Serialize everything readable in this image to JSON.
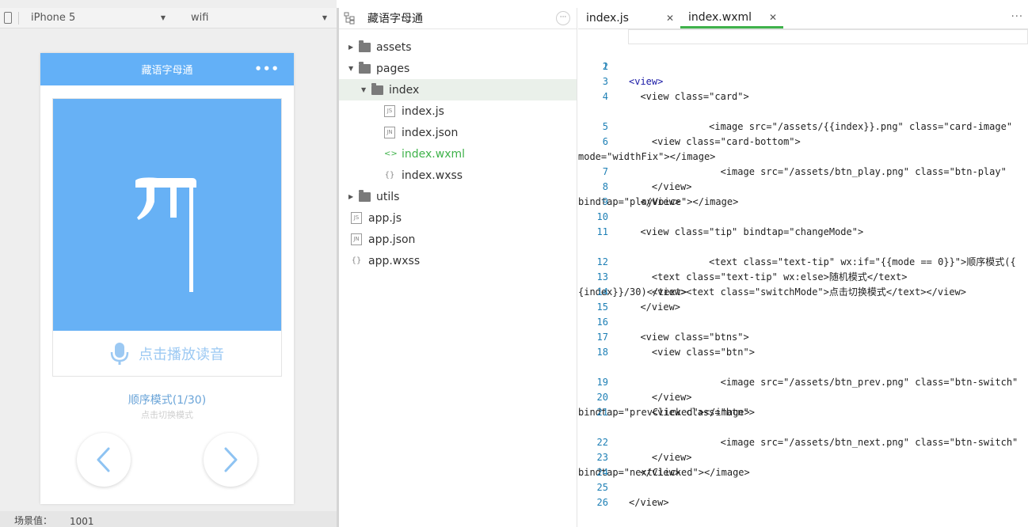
{
  "simulator": {
    "toolbar": {
      "device": "iPhone 5",
      "network": "wifi"
    },
    "phone": {
      "nav_title": "藏语字母通",
      "nav_more": "•••",
      "card_bottom_label": "点击播放读音",
      "tip_text": "顺序模式(1/30)",
      "switch_text": "点击切换模式",
      "accent": "#63b0f7"
    },
    "status": {
      "label": "场景值：",
      "value": "1001"
    }
  },
  "tree": {
    "title": "藏语字母通",
    "more": "···",
    "items": [
      {
        "label": "assets",
        "type": "folder"
      },
      {
        "label": "pages",
        "type": "folder"
      },
      {
        "label": "index",
        "type": "folder"
      },
      {
        "label": "index.js",
        "type": "file",
        "icon": "JS"
      },
      {
        "label": "index.json",
        "type": "file",
        "icon": "JN"
      },
      {
        "label": "index.wxml",
        "type": "file",
        "icon": "<>"
      },
      {
        "label": "index.wxss",
        "type": "file",
        "icon": "{}"
      },
      {
        "label": "utils",
        "type": "folder"
      },
      {
        "label": "app.js",
        "type": "file",
        "icon": "JS"
      },
      {
        "label": "app.json",
        "type": "file",
        "icon": "JN"
      },
      {
        "label": "app.wxss",
        "type": "file",
        "icon": "{}"
      }
    ]
  },
  "editor": {
    "tabs": [
      {
        "label": "index.js"
      },
      {
        "label": "index.wxml"
      }
    ],
    "close_glyph": "✕",
    "more": "···",
    "line_numbers": [
      "1",
      "2",
      "3",
      "4",
      "5",
      "6",
      "7",
      "8",
      "9",
      "10",
      "11",
      "12",
      "13",
      "14",
      "15",
      "16",
      "17",
      "18",
      "19",
      "20",
      "21",
      "22",
      "23",
      "24",
      "25",
      "26"
    ],
    "code": {
      "l1": "<view>",
      "l3": "  <view class=\"card\">",
      "l4a": "    <image src=\"/assets/{{index}}.png\" class=\"card-image\"",
      "l4b": "mode=\"widthFix\"></image>",
      "l5": "    <view class=\"card-bottom\">",
      "l6a": "      <image src=\"/assets/btn_play.png\" class=\"btn-play\"",
      "l6b": "bindtap=\"playVoice\"></image>",
      "l7": "    </view>",
      "l8": "  </view>",
      "l10": "  <view class=\"tip\" bindtap=\"changeMode\">",
      "l11a": "    <text class=\"text-tip\" wx:if=\"{{mode == 0}}\">顺序模式({",
      "l11b": "{index}}/30)</text>",
      "l12": "    <text class=\"text-tip\" wx:else>随机模式</text>",
      "l13": "    <view><text class=\"switchMode\">点击切换模式</text></view>",
      "l14": "  </view>",
      "l16": "  <view class=\"btns\">",
      "l17": "    <view class=\"btn\">",
      "l18a": "      <image src=\"/assets/btn_prev.png\" class=\"btn-switch\"",
      "l18b": "bindtap=\"prevClicked\"></image>",
      "l19": "    </view>",
      "l20": "    <view class=\"btn\">",
      "l21a": "      <image src=\"/assets/btn_next.png\" class=\"btn-switch\"",
      "l21b": "bindtap=\"nextClicked\"></image>",
      "l22": "    </view>",
      "l23": "  </view>",
      "l25": "</view>"
    }
  }
}
